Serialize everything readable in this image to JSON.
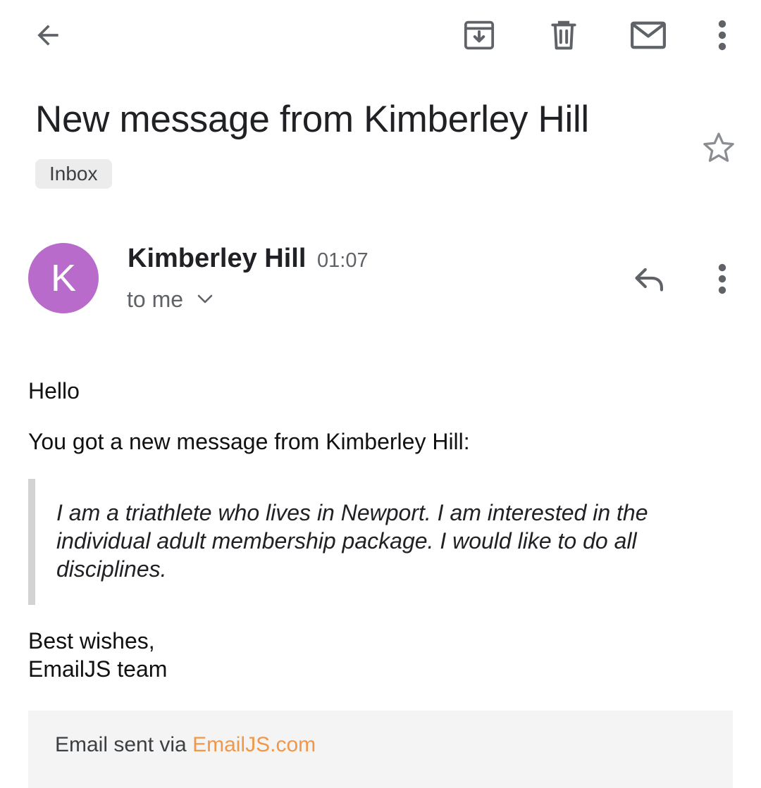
{
  "toolbar": {
    "back_icon": "arrow-back-icon",
    "archive_icon": "archive-icon",
    "delete_icon": "delete-icon",
    "mark_unread_icon": "mail-icon",
    "more_icon": "more-vert-icon"
  },
  "email": {
    "subject": "New message from Kimberley Hill",
    "label": "Inbox",
    "starred": false,
    "sender": {
      "initial": "K",
      "name": "Kimberley Hill",
      "time": "01:07",
      "avatar_color": "#b96bcb"
    },
    "recipient_label": "to me",
    "body": {
      "greeting": "Hello",
      "intro": "You got a new message from Kimberley Hill:",
      "quote": "I am a triathlete who lives in Newport. I am interested in the individual adult membership package. I would like to do all disciplines.",
      "signoff_line1": "Best wishes,",
      "signoff_line2": "EmailJS team"
    },
    "footer": {
      "prefix": "Email sent via ",
      "link_text": "EmailJS.com",
      "link_color": "#f0984a"
    }
  }
}
